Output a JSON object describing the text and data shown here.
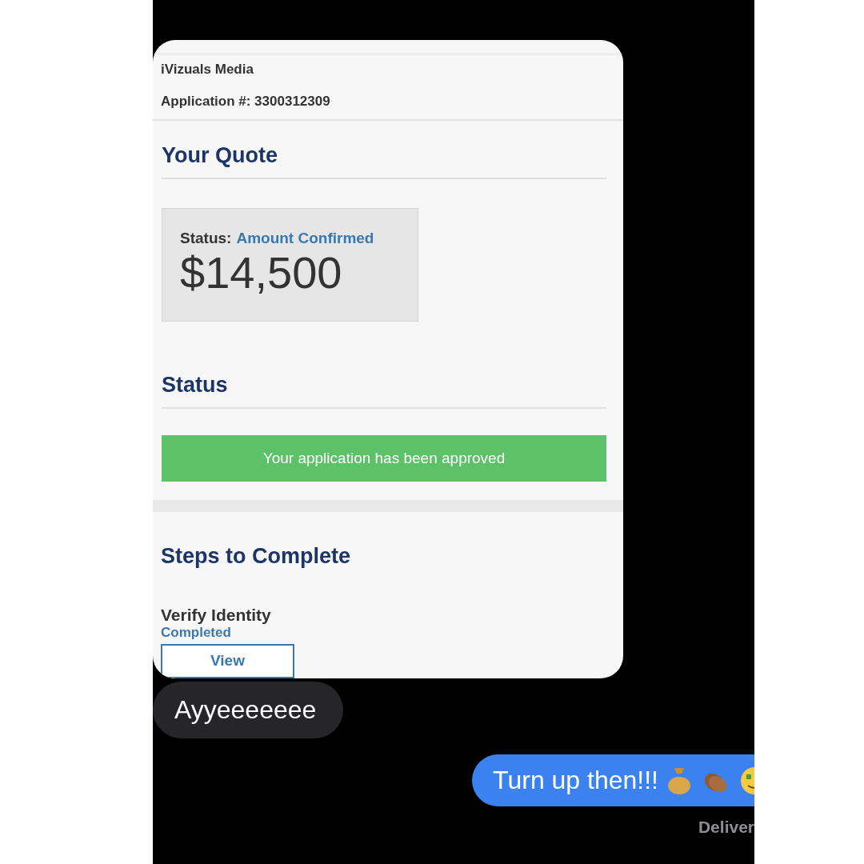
{
  "attachment": {
    "company": "iVizuals Media",
    "application": "Application #: 3300312309",
    "quote_heading": "Your Quote",
    "quote_card": {
      "status_label": "Status:",
      "status_value": "Amount Confirmed",
      "amount": "$14,500"
    },
    "status_heading": "Status",
    "status_banner": "Your application has been approved",
    "steps_heading": "Steps to Complete",
    "steps": [
      {
        "title": "Verify Identity",
        "state": "Completed",
        "button": "View"
      }
    ]
  },
  "messages": [
    {
      "kind": "received",
      "text": "Ayyeeeeeee"
    },
    {
      "kind": "sent",
      "text": "Turn up then!!!"
    }
  ],
  "receipt": "Deliver"
}
